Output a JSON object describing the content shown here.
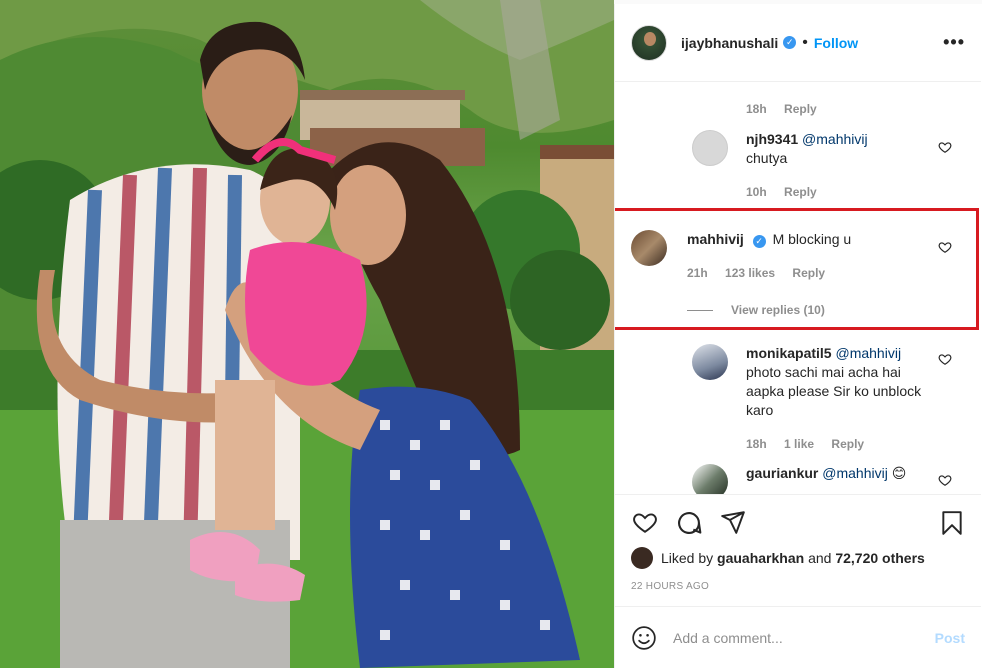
{
  "post": {
    "author": "ijaybhanushali",
    "dot": "•",
    "follow_label": "Follow",
    "more_label": "•••"
  },
  "comments": [
    {
      "meta": {
        "time": "18h",
        "reply": "Reply"
      }
    },
    {
      "user": "njh9341",
      "mention": "@mahhivij",
      "text": "chutya",
      "time": "10h",
      "reply": "Reply"
    },
    {
      "user": "mahhivij",
      "text": "M blocking u",
      "time": "21h",
      "likes": "123 likes",
      "reply": "Reply",
      "view_replies": "View replies (10)"
    },
    {
      "user": "monikapatil5",
      "mention": "@mahhivij",
      "text": "photo sachi mai acha hai aapka please Sir ko unblock karo",
      "time": "18h",
      "likes": "1 like",
      "reply": "Reply"
    },
    {
      "user": "gauriankur",
      "mention": "@mahhivij",
      "emoji": "😊"
    }
  ],
  "likes": {
    "prefix": "Liked by",
    "user": "gauaharkhan",
    "middle": "and",
    "count": "72,720 others"
  },
  "timestamp": "22 HOURS AGO",
  "add_comment": {
    "placeholder": "Add a comment...",
    "post_label": "Post",
    "emoji_icon": "smiley-icon"
  },
  "colors": {
    "highlight": "#d71a20",
    "link": "#0095f6",
    "post_disabled": "#b3dbff",
    "muted": "#8e8e8e"
  }
}
